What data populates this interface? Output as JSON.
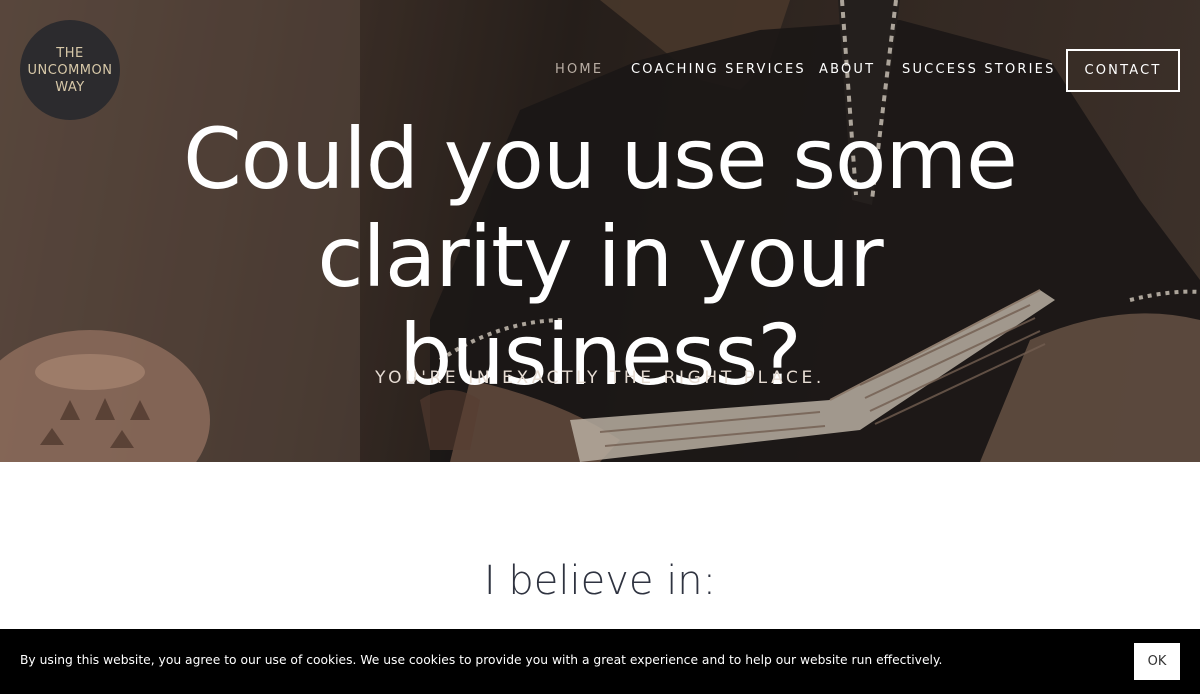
{
  "logo": {
    "line1": "THE",
    "line2": "UNCOMMON",
    "line3": "WAY"
  },
  "nav": {
    "home": "HOME",
    "coaching": "COACHING SERVICES",
    "about": "ABOUT",
    "stories": "SUCCESS STORIES",
    "contact": "CONTACT"
  },
  "hero": {
    "title_line1": "Could you use some",
    "title_line2": "clarity in your business?",
    "subtitle": "YOU'RE IN EXACTLY THE RIGHT PLACE."
  },
  "section": {
    "heading": "I believe in:"
  },
  "cookie": {
    "text": "By using this website, you agree to our use of cookies. We use cookies to provide you with a great experience and to help our website run effectively.",
    "ok": "OK"
  }
}
